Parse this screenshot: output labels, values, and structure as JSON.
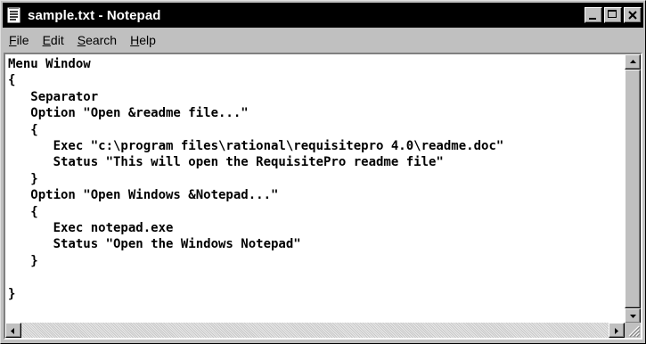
{
  "window": {
    "title": "sample.txt - Notepad"
  },
  "menu": [
    {
      "label": "File",
      "accel": "F",
      "rest": "ile"
    },
    {
      "label": "Edit",
      "accel": "E",
      "rest": "dit"
    },
    {
      "label": "Search",
      "accel": "S",
      "rest": "earch"
    },
    {
      "label": "Help",
      "accel": "H",
      "rest": "elp"
    }
  ],
  "editor": {
    "content": "Menu Window\n{\n   Separator\n   Option \"Open &readme file...\"\n   {\n      Exec \"c:\\program files\\rational\\requisitepro 4.0\\readme.doc\"\n      Status \"This will open the RequisitePro readme file\"\n   }\n   Option \"Open Windows &Notepad...\"\n   {\n      Exec notepad.exe\n      Status \"Open the Windows Notepad\"\n   }\n\n}"
  },
  "icons": {
    "app": "notepad-icon",
    "minimize": "minimize-icon",
    "maximize": "maximize-icon",
    "close": "close-icon",
    "scroll_up": "arrow-up-icon",
    "scroll_down": "arrow-down-icon",
    "scroll_left": "arrow-left-icon",
    "scroll_right": "arrow-right-icon"
  },
  "colors": {
    "titlebar_bg": "#000000",
    "titlebar_text": "#ffffff",
    "chrome": "#c0c0c0",
    "editor_bg": "#ffffff"
  }
}
